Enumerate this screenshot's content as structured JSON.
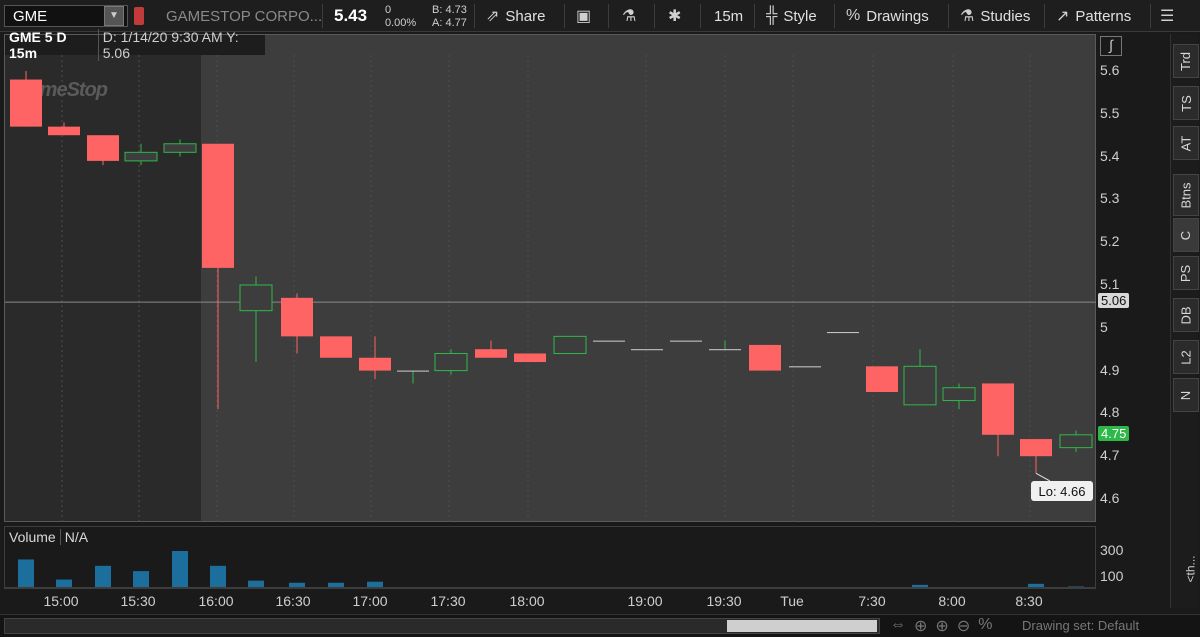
{
  "toolbar": {
    "symbol": "GME",
    "company": "GAMESTOP CORPO...",
    "last_price": "5.43",
    "change": "0",
    "change_pct": "0.00%",
    "bid": "B: 4.73",
    "ask": "A: 4.77",
    "share_label": "Share",
    "timeframe": "15m",
    "style_label": "Style",
    "drawings_label": "Drawings",
    "studies_label": "Studies",
    "patterns_label": "Patterns"
  },
  "chart_header": {
    "title": "GME 5 D 15m",
    "info": "D: 1/14/20 9:30 AM  Y: 5.06"
  },
  "watermark": "GameStop",
  "price_axis": {
    "labels": [
      "5.6",
      "5.5",
      "5.4",
      "5.3",
      "5.2",
      "5.1",
      "5",
      "4.9",
      "4.8",
      "4.7",
      "4.6"
    ],
    "crosshair_value": "5.06",
    "last_value": "4.75",
    "low_label": "Lo: 4.66"
  },
  "volume": {
    "title": "Volume",
    "value": "N/A",
    "axis_labels": [
      "300",
      "100"
    ]
  },
  "time_axis": {
    "labels": [
      "15:00",
      "15:30",
      "16:00",
      "16:30",
      "17:00",
      "17:30",
      "18:00",
      "19:00",
      "19:30",
      "Tue",
      "7:30",
      "8:00",
      "8:30"
    ]
  },
  "sidebar": {
    "tabs": [
      "Trd",
      "TS",
      "AT",
      "Btns",
      "C",
      "PS",
      "DB",
      "L2",
      "N"
    ],
    "active": "C",
    "collapsed_label": "<th..."
  },
  "bottom": {
    "drawing_set": "Drawing set: Default"
  },
  "colors": {
    "up": "#2fb84a",
    "down": "#ff6464",
    "last_badge": "#2fb84a"
  },
  "chart_data": {
    "type": "candlestick",
    "y_range": [
      4.55,
      5.65
    ],
    "candles": [
      {
        "o": 5.58,
        "h": 5.6,
        "l": 5.47,
        "c": 5.47
      },
      {
        "o": 5.47,
        "h": 5.48,
        "l": 5.45,
        "c": 5.45
      },
      {
        "o": 5.45,
        "h": 5.45,
        "l": 5.38,
        "c": 5.39
      },
      {
        "o": 5.39,
        "h": 5.43,
        "l": 5.38,
        "c": 5.41
      },
      {
        "o": 5.41,
        "h": 5.44,
        "l": 5.4,
        "c": 5.43
      },
      {
        "o": 5.43,
        "h": 5.43,
        "l": 4.81,
        "c": 5.14
      },
      {
        "o": 5.04,
        "h": 5.12,
        "l": 4.92,
        "c": 5.1
      },
      {
        "o": 5.07,
        "h": 5.08,
        "l": 4.94,
        "c": 4.98
      },
      {
        "o": 4.98,
        "h": 4.98,
        "l": 4.93,
        "c": 4.93
      },
      {
        "o": 4.93,
        "h": 4.98,
        "l": 4.88,
        "c": 4.9
      },
      {
        "o": 4.9,
        "h": 4.9,
        "l": 4.87,
        "c": 4.9
      },
      {
        "o": 4.9,
        "h": 4.95,
        "l": 4.89,
        "c": 4.94
      },
      {
        "o": 4.95,
        "h": 4.97,
        "l": 4.93,
        "c": 4.93
      },
      {
        "o": 4.94,
        "h": 4.94,
        "l": 4.92,
        "c": 4.92
      },
      {
        "o": 4.94,
        "h": 4.98,
        "l": 4.94,
        "c": 4.98
      },
      {
        "o": 4.97,
        "h": 4.97,
        "l": 4.97,
        "c": 4.97
      },
      {
        "o": 4.95,
        "h": 4.95,
        "l": 4.95,
        "c": 4.95
      },
      {
        "o": 4.97,
        "h": 4.97,
        "l": 4.97,
        "c": 4.97
      },
      {
        "o": 4.95,
        "h": 4.97,
        "l": 4.95,
        "c": 4.95
      },
      {
        "o": 4.96,
        "h": 4.96,
        "l": 4.9,
        "c": 4.9
      },
      {
        "o": 4.91,
        "h": 4.91,
        "l": 4.91,
        "c": 4.91
      },
      {
        "o": 4.99,
        "h": 4.99,
        "l": 4.99,
        "c": 4.99
      },
      {
        "o": 4.91,
        "h": 4.91,
        "l": 4.85,
        "c": 4.85
      },
      {
        "o": 4.82,
        "h": 4.95,
        "l": 4.82,
        "c": 4.91
      },
      {
        "o": 4.83,
        "h": 4.87,
        "l": 4.81,
        "c": 4.86
      },
      {
        "o": 4.87,
        "h": 4.87,
        "l": 4.7,
        "c": 4.75
      },
      {
        "o": 4.74,
        "h": 4.74,
        "l": 4.66,
        "c": 4.7
      },
      {
        "o": 4.72,
        "h": 4.76,
        "l": 4.71,
        "c": 4.75
      }
    ],
    "candle_x_index": [
      0,
      1,
      2,
      3,
      4,
      5,
      6,
      7,
      8,
      9,
      10,
      11,
      12,
      13,
      14,
      15,
      16,
      17,
      18,
      19,
      20,
      21,
      22,
      23,
      24,
      25,
      26,
      27
    ],
    "volume": [
      260,
      70,
      200,
      150,
      340,
      200,
      60,
      40,
      40,
      50,
      0,
      0,
      0,
      0,
      0,
      0,
      0,
      0,
      0,
      0,
      0,
      0,
      0,
      20,
      0,
      0,
      30,
      5
    ],
    "crosshair_y": 5.06
  }
}
